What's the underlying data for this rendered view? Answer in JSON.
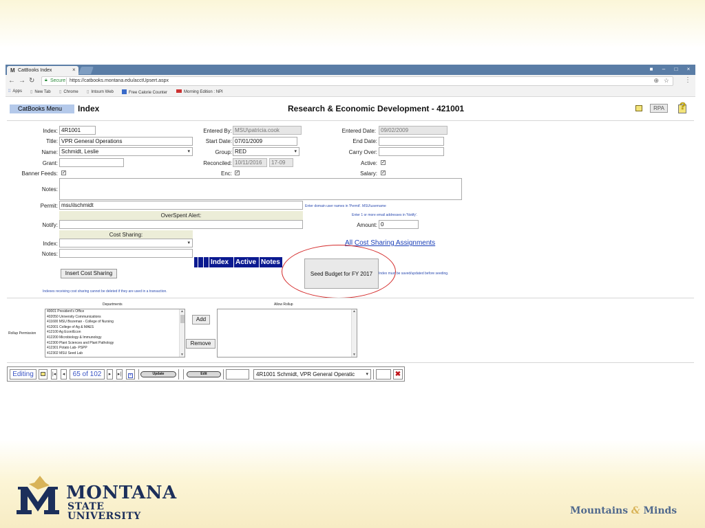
{
  "browser": {
    "tab_title": "CatBooks Index",
    "tab_favicon": "M",
    "secure_label": "Secure",
    "url": "https://catbooks.montana.edu/acctUpsert.aspx",
    "bookmarks": [
      "Apps",
      "New Tab",
      "Chrome",
      "Intourn Web",
      "Free Calorie Counter",
      "Morning Edition : NPI"
    ]
  },
  "header": {
    "menu_label": "CatBooks Menu",
    "page_title": "Index",
    "dept_title": "Research & Economic Development - 421001",
    "rpa_label": "RPA"
  },
  "form": {
    "index_label": "Index:",
    "index_value": "4R1001",
    "title_label": "Title:",
    "title_value": "VPR General Operations",
    "name_label": "Name:",
    "name_value": "Schmidt, Leslie",
    "grant_label": "Grant:",
    "grant_value": "",
    "banner_feeds_label": "Banner Feeds:",
    "entered_by_label": "Entered By:",
    "entered_by_value": "MSU\\patricia.cook",
    "start_date_label": "Start Date:",
    "start_date_value": "07/01/2009",
    "group_label": "Group:",
    "group_value": "RED",
    "reconciled_label": "Reconciled:",
    "reconciled_date": "10/11/2016",
    "reconciled_code": "17-09",
    "enc_label": "Enc:",
    "entered_date_label": "Entered Date:",
    "entered_date_value": "09/02/2009",
    "end_date_label": "End Date:",
    "end_date_value": "",
    "carry_over_label": "Carry Over:",
    "carry_over_value": "",
    "active_label": "Active:",
    "salary_label": "Salary:",
    "notes_label": "Notes:",
    "permit_label": "Permit:",
    "permit_value": "msu\\lschmidt",
    "permit_hint": "Enter domain user names in 'Permit'. MSU\\username",
    "overspent_label": "OverSpent Alert:",
    "notify_hint": "Enter 1 or more email addresses in 'Notify'.",
    "notify_label": "Notify:",
    "amount_label": "Amount:",
    "amount_value": "0",
    "cost_sharing_label": "Cost Sharing:",
    "cs_index_label": "Index:",
    "cs_notes_label": "Notes:",
    "all_cost_sharing_link": "All Cost Sharing Assignments",
    "table_headers": [
      "Index",
      "Active",
      "Notes"
    ],
    "insert_cost_sharing_label": "Insert Cost Sharing",
    "seed_budget_label": "Seed Budget for FY 2017",
    "seed_hint": "Index must be saved/updated before seeding.",
    "cost_sharing_warning": "Indexes receiving cost sharing cannot be deleted if they are used in a transaction."
  },
  "rollup": {
    "permission_label": "Rollup Permission",
    "departments_label": "Departments",
    "allow_rollup_label": "Allow Rollup",
    "add_label": "Add",
    "remove_label": "Remove",
    "departments": [
      "40001 President's Office",
      "402050 University Communications",
      "411600 MSU Bozeman - College of Nursing",
      "412001 College of Ag & MAES",
      "412100 Ag Econ/Econ",
      "412200 Microbiology & Immunology",
      "412300 Plant Sciences and Plant Pathology",
      "412301 Potato Lab- PSPP",
      "412302 MSU Seed Lab"
    ]
  },
  "navigator": {
    "mode": "Editing",
    "record_position": "65 of 102",
    "update_label": "Update",
    "edit_label": "Edit",
    "search_value": "",
    "record_select": "4R1001 Schmidt, VPR General Operatic"
  },
  "footer": {
    "logo_name": "MONTANA",
    "logo_sub": "STATE UNIVERSITY",
    "tagline_left": "Mountains",
    "tagline_amp": "&",
    "tagline_right": "Minds"
  },
  "colors": {
    "menu_button": "#b4c9ea",
    "table_header": "#0b1a90",
    "highlight_circle": "#d42a2a",
    "msu_blue": "#1c2f5b",
    "msu_gold": "#d8b358"
  }
}
